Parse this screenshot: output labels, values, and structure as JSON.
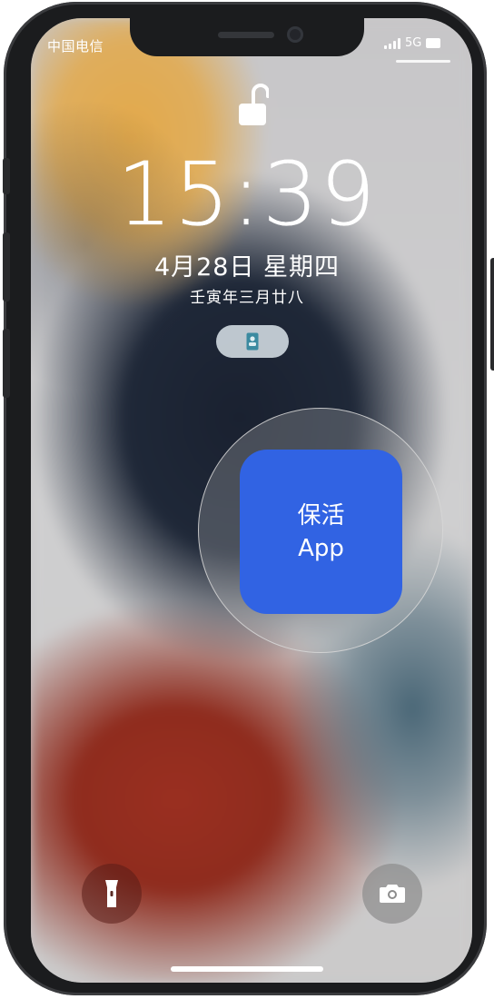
{
  "status_bar": {
    "carrier": "中国电信",
    "network": "5G",
    "signal_bars": 4
  },
  "lock_screen": {
    "lock_state": "unlocked",
    "time": "15:39",
    "date": "4月28日 星期四",
    "lunar_date": "壬寅年三月廿八"
  },
  "widget": {
    "icon": "contact-card-icon"
  },
  "focus_app": {
    "line1": "保活",
    "line2": "App",
    "color": "#3163e3"
  },
  "quick_actions": {
    "left_icon": "flashlight-icon",
    "right_icon": "camera-icon"
  },
  "colors": {
    "accent_blue": "#3163e3",
    "frame": "#1b1c1e"
  }
}
